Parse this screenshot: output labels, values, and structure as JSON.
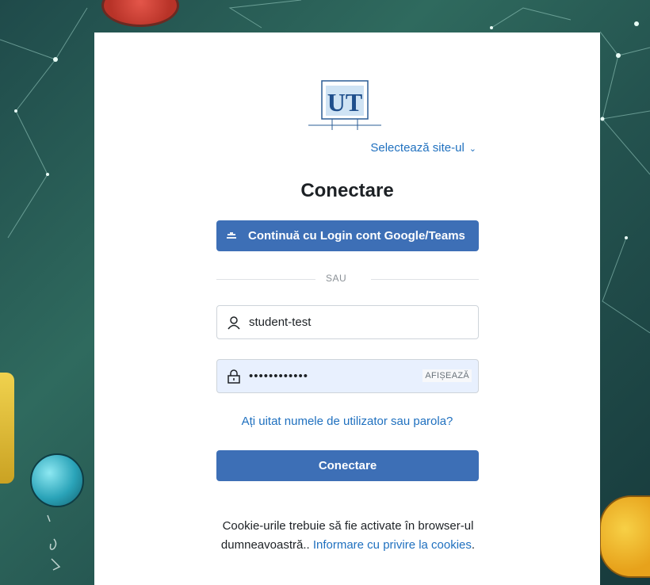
{
  "site_select": {
    "label": "Selectează site-ul",
    "chevron_icon": "chevron-down-icon"
  },
  "logo": {
    "alt_icon": "ut-logo"
  },
  "login": {
    "title": "Conectare",
    "google_button": "Continuă cu Login cont Google/Teams",
    "divider": "SAU",
    "username_value": "student-test",
    "password_value": "••••••••••••",
    "show_password": "AFIȘEAZĂ",
    "forgot_link": "Ați uitat numele de utilizator sau parola?",
    "submit_button": "Conectare"
  },
  "cookie_notice": {
    "text": "Cookie-urile trebuie să fie activate în browser-ul dumneavoastră.. ",
    "link": "Informare cu privire la cookies",
    "end": "."
  },
  "colors": {
    "primary": "#3d6fb6",
    "link": "#1f70bf",
    "autofill_bg": "#e8f0fe"
  }
}
